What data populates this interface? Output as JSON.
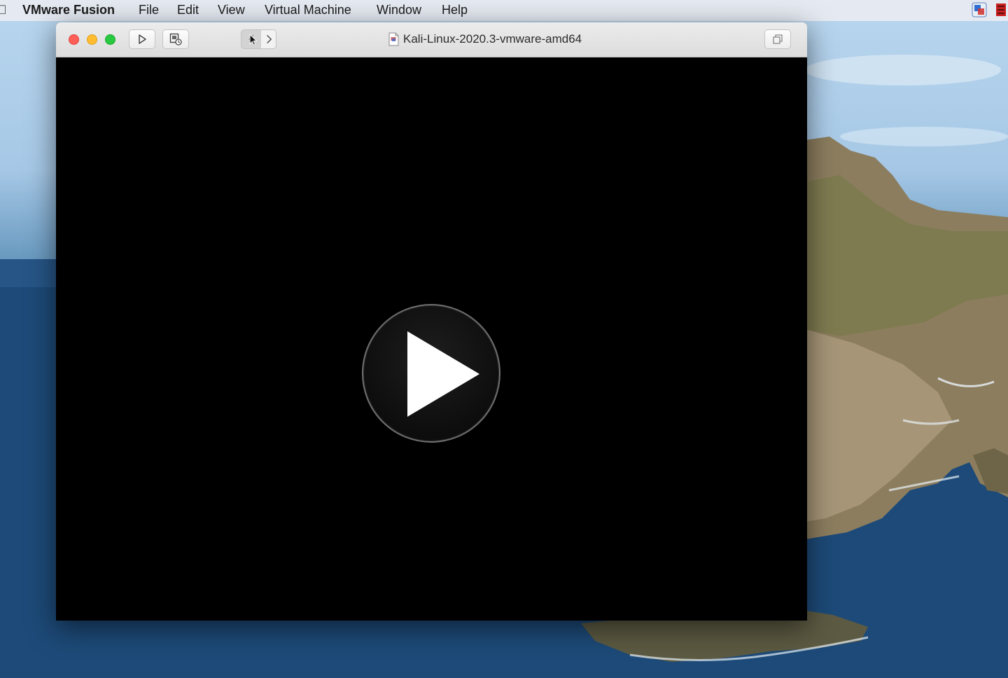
{
  "menubar": {
    "app_name": "VMware Fusion",
    "items": [
      "File",
      "Edit",
      "View",
      "Virtual Machine",
      "Window",
      "Help"
    ]
  },
  "window": {
    "title": "Kali-Linux-2020.3-vmware-amd64"
  },
  "icons": {
    "close": "close-icon",
    "minimize": "minimize-icon",
    "maximize": "maximize-icon",
    "play": "play-icon",
    "snapshot": "snapshot-icon",
    "back": "chevron-left-icon",
    "forward": "chevron-right-icon",
    "restore": "restore-window-icon",
    "vm_file": "vm-file-icon",
    "big_play": "play-icon"
  },
  "colors": {
    "close": "#ff5f57",
    "minimize": "#febc2e",
    "maximize": "#28c840",
    "console": "#000000"
  }
}
